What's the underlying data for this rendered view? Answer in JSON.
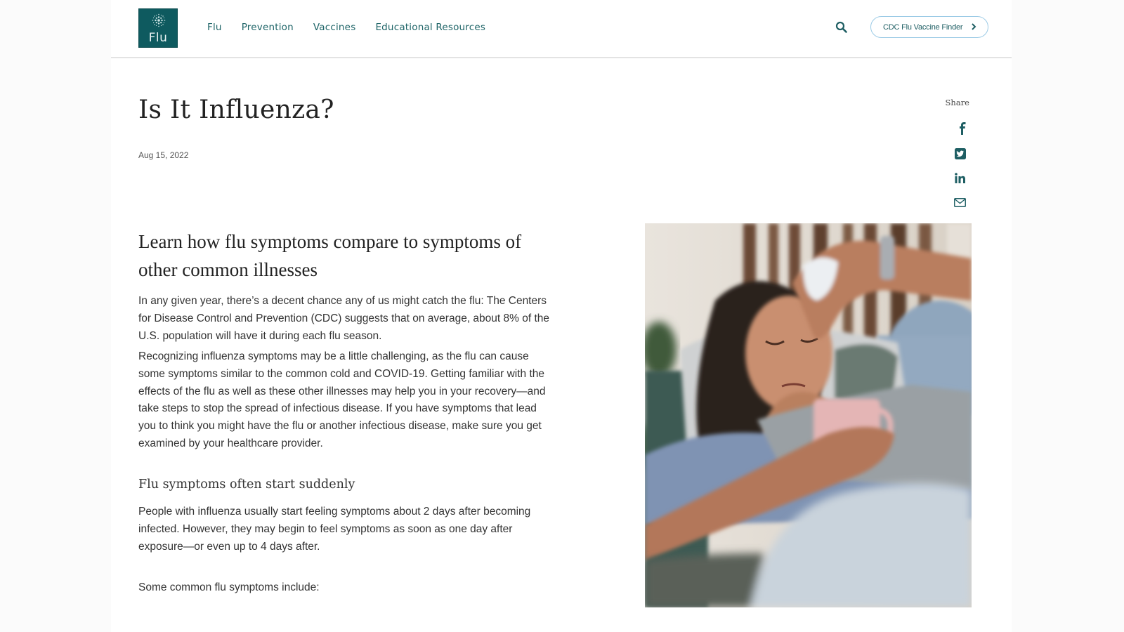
{
  "header": {
    "logo_text": "Flu",
    "nav": [
      "Flu",
      "Prevention",
      "Vaccines",
      "Educational Resources"
    ],
    "search_icon": "search-icon",
    "finder_button": "CDC Flu Vaccine Finder",
    "finder_icon": "chevron-right-icon"
  },
  "article": {
    "title": "Is It Influenza?",
    "date": "Aug 15, 2022",
    "subheading": "Learn how flu symptoms compare to symptoms of other common illnesses",
    "paragraphs": [
      "In any given year, there’s a decent chance any of us might catch the flu: The Centers for Disease Control and Prevention (CDC) suggests that on average, about 8% of the U.S. population will have it during each flu season.",
      "Recognizing influenza symptoms may be a little challenging, as the flu can cause some symptoms similar to the common cold and COVID-19. Getting familiar with the effects of the flu as well as these other illnesses may help you in your recovery—and take steps to stop the spread of infectious disease. If you have symptoms that lead you to think you might have the flu or another infectious disease, make sure you get examined by your healthcare provider."
    ],
    "section_heading": "Flu symptoms often start suddenly",
    "section_paragraph": "People with influenza usually start feeling symptoms about 2 days after becoming infected. However, they may begin to feel symptoms as soon as one day after exposure—or even up to 4 days after.",
    "list_intro": "Some common flu symptoms include:",
    "image_description": "Woman lying on a couch holding a tissue to her forehead and a pink mug"
  },
  "share": {
    "label": "Share",
    "icons": [
      "facebook-icon",
      "twitter-icon",
      "linkedin-icon",
      "email-icon"
    ]
  },
  "colors": {
    "brand_teal": "#0e5a5f",
    "nav_text": "#1e6467",
    "button_border": "#9ccbe6"
  }
}
